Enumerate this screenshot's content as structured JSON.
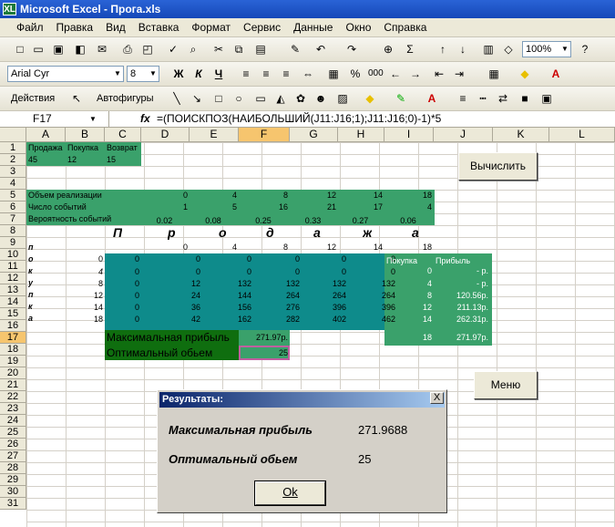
{
  "window": {
    "title": "Microsoft Excel - Прога.xls",
    "app_icon": "XL"
  },
  "menu": [
    "Файл",
    "Правка",
    "Вид",
    "Вставка",
    "Формат",
    "Сервис",
    "Данные",
    "Окно",
    "Справка"
  ],
  "toolbar1": {
    "zoom": "100%"
  },
  "toolbar2": {
    "font": "Arial Cyr",
    "size": "8",
    "bold": "Ж",
    "italic": "К",
    "underline": "Ч",
    "percent": "%",
    "thousands": "000"
  },
  "toolbar3": {
    "actions": "Действия",
    "autoshapes": "Автофигуры"
  },
  "formula_bar": {
    "cell": "F17",
    "fx": "fx",
    "formula": "=(ПОИСКПОЗ(НАИБОЛЬШИЙ(J11:J16;1);J11:J16;0)-1)*5"
  },
  "columns": [
    "A",
    "B",
    "C",
    "D",
    "E",
    "F",
    "G",
    "H",
    "I",
    "J",
    "K",
    "L"
  ],
  "rows": [
    "1",
    "2",
    "3",
    "4",
    "5",
    "6",
    "7",
    "8",
    "9",
    "10",
    "11",
    "12",
    "13",
    "14",
    "15",
    "16",
    "17",
    "18",
    "19",
    "20",
    "21",
    "22",
    "23",
    "24",
    "25",
    "26",
    "27",
    "28",
    "29",
    "30",
    "31"
  ],
  "r1": [
    "Продажа",
    "Покупка",
    "Возврат"
  ],
  "r2": [
    "45",
    "12",
    "15"
  ],
  "r5": {
    "label": "Объем реализации",
    "values": [
      "0",
      "4",
      "8",
      "12",
      "14",
      "18"
    ]
  },
  "r6": {
    "label": "Число событий",
    "values": [
      "1",
      "5",
      "16",
      "21",
      "17",
      "4"
    ]
  },
  "r7": {
    "label": "Вероятность событий",
    "values": [
      "0.02",
      "0.08",
      "0.25",
      "0.33",
      "0.27",
      "0.06"
    ]
  },
  "sales_letters": [
    "П",
    "р",
    "о",
    "д",
    "а",
    "ж",
    "а"
  ],
  "purchase_letters": [
    "п",
    "о",
    "к",
    "у",
    "п",
    "к",
    "а"
  ],
  "r9_values": [
    "0",
    "4",
    "8",
    "12",
    "14",
    "18"
  ],
  "row_b_values": [
    "0",
    "4",
    "8",
    "12",
    "14",
    "18"
  ],
  "matrix": [
    [
      "0",
      "0",
      "0",
      "0",
      "0",
      "0"
    ],
    [
      "0",
      "0",
      "0",
      "0",
      "0",
      "0"
    ],
    [
      "0",
      "12",
      "132",
      "132",
      "132",
      "132"
    ],
    [
      "0",
      "24",
      "144",
      "264",
      "264",
      "264"
    ],
    [
      "0",
      "36",
      "156",
      "276",
      "396",
      "396"
    ],
    [
      "0",
      "42",
      "162",
      "282",
      "402",
      "462"
    ]
  ],
  "right_table": {
    "h1": "Покупка",
    "h2": "Прибыль",
    "rows": [
      [
        "0",
        "-   р."
      ],
      [
        "4",
        "-   р."
      ],
      [
        "8",
        "120.56р."
      ],
      [
        "12",
        "211.13р."
      ],
      [
        "14",
        "262.31р."
      ],
      [
        "18",
        "271.97р."
      ]
    ]
  },
  "r16": {
    "label": "Максимальная прибыль",
    "value": "271.97р."
  },
  "r17": {
    "label": "Оптимальный обьем",
    "value": "25"
  },
  "buttons": {
    "calc": "Вычислить",
    "menu": "Меню"
  },
  "dialog": {
    "title": "Результаты:",
    "close": "X",
    "max_label": "Максимальная прибыль",
    "max_value": "271.9688",
    "opt_label": "Оптимальный обьем",
    "opt_value": "25",
    "ok": "Ok"
  }
}
